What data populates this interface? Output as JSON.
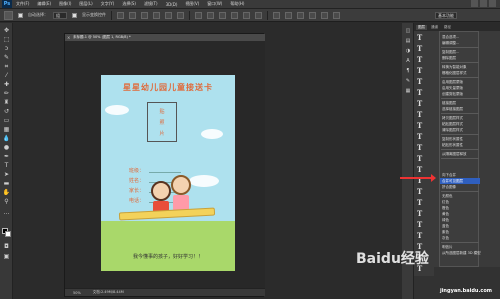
{
  "menubar": {
    "logo": "Ps",
    "items": [
      "文件(F)",
      "编辑(E)",
      "图像(I)",
      "图层(L)",
      "文字(Y)",
      "选择(S)",
      "滤镜(T)",
      "3D(D)",
      "视图(V)",
      "窗口(W)",
      "帮助(H)"
    ]
  },
  "options": {
    "auto_select_label": "自动选择：",
    "auto_select_value": "组",
    "show_transform_label": "显示变换控件",
    "workspace": "基本功能"
  },
  "document": {
    "tab_title": "未标题-1 @ 50% (图层 1, RGB/8) *",
    "close": "×",
    "zoom": "50%",
    "status": "文档:2.49M/8.44M"
  },
  "card": {
    "heading": "星星幼儿园儿童接送卡",
    "photo_lines": [
      "贴",
      "照",
      "片"
    ],
    "fields": [
      "班级：",
      "姓名：",
      "家长：",
      "电话："
    ],
    "slogan": "我今懂事的孩子，好好学习！！"
  },
  "panel": {
    "tabs": [
      "图层",
      "通道",
      "路径"
    ],
    "layer_glyphs": [
      "T",
      "T",
      "T",
      "T",
      "T",
      "T",
      "T",
      "T",
      "T",
      "T",
      "T",
      "T",
      "T",
      "T",
      "T",
      "T",
      "T",
      "T",
      "T",
      "T",
      "T",
      "T"
    ]
  },
  "context_menu": {
    "items": [
      "混合选项...",
      "编辑调整...",
      "复制图层...",
      "删除图层",
      "转换为智能对象",
      "栅格化图层样式",
      "启用图层蒙版",
      "启用矢量蒙版",
      "创建剪贴蒙版",
      "链接图层",
      "选择链接图层",
      "拷贝图层样式",
      "粘贴图层样式",
      "清除图层样式",
      "复制形状属性",
      "粘贴形状属性",
      "从隔离图层释放",
      "向下合并",
      "合并可见图层",
      "拼合图像",
      "无颜色",
      "红色",
      "橙色",
      "黄色",
      "绿色",
      "蓝色",
      "紫色",
      "灰色",
      "明信片",
      "从所选图层新建 3D 模型"
    ],
    "highlighted_index": 18
  },
  "watermark": {
    "brand": "Baidu经验",
    "url": "jingyan.baidu.com"
  },
  "colors": {
    "accent_highlight": "#2f5fbf",
    "arrow": "#e33333",
    "card_bg": "#aee1ee",
    "heading": "#e06a3a"
  }
}
